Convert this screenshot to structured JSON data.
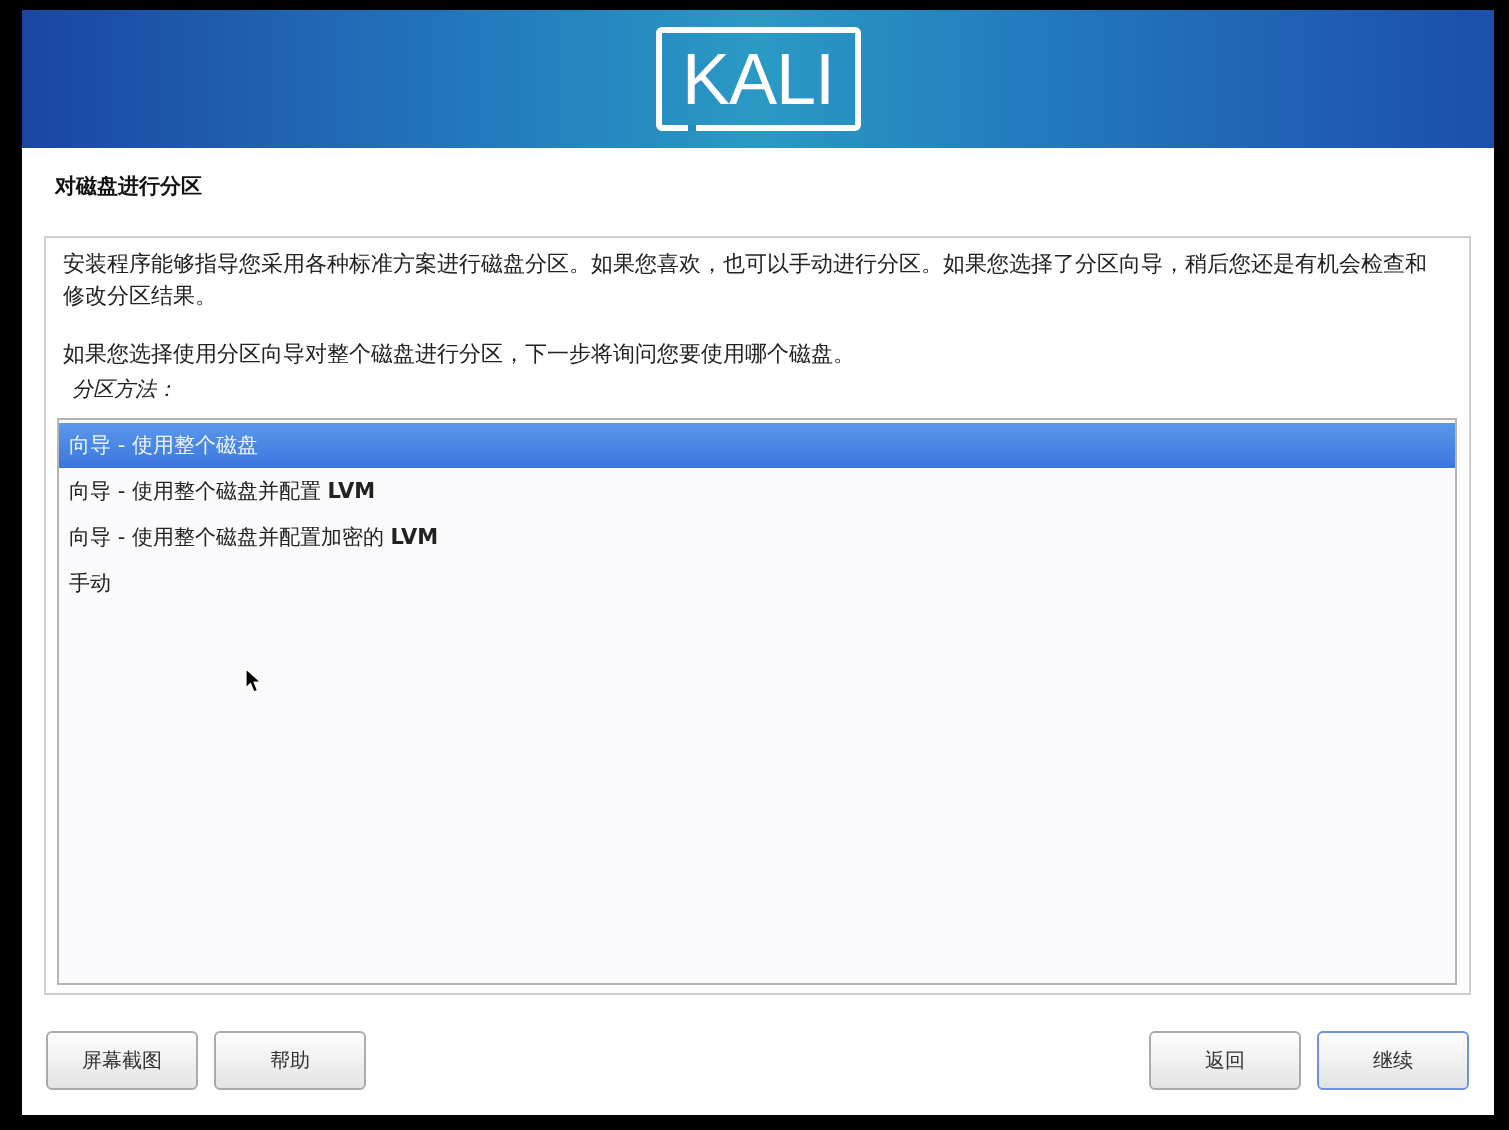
{
  "header": {
    "logo": "KALI"
  },
  "title": "对磁盘进行分区",
  "description": [
    "安装程序能够指导您采用各种标准方案进行磁盘分区。如果您喜欢，也可以手动进行分区。如果您选择了分区向导，稍后您还是有机会检查和修改分区结果。",
    "如果您选择使用分区向导对整个磁盘进行分区，下一步将询问您要使用哪个磁盘。"
  ],
  "partition_method": {
    "label": "分区方法：",
    "options": [
      {
        "label": "向导 - 使用整个磁盘",
        "selected": true
      },
      {
        "label": "向导 - 使用整个磁盘并配置 **LVM**",
        "selected": false
      },
      {
        "label": "向导 - 使用整个磁盘并配置加密的 **LVM**",
        "selected": false
      },
      {
        "label": "手动",
        "selected": false
      }
    ]
  },
  "buttons_left": [
    {
      "label": "屏幕截图",
      "focused": false
    },
    {
      "label": "帮助",
      "focused": false
    }
  ],
  "buttons_right": [
    {
      "label": "返回",
      "focused": false
    },
    {
      "label": "继续",
      "focused": true
    }
  ]
}
